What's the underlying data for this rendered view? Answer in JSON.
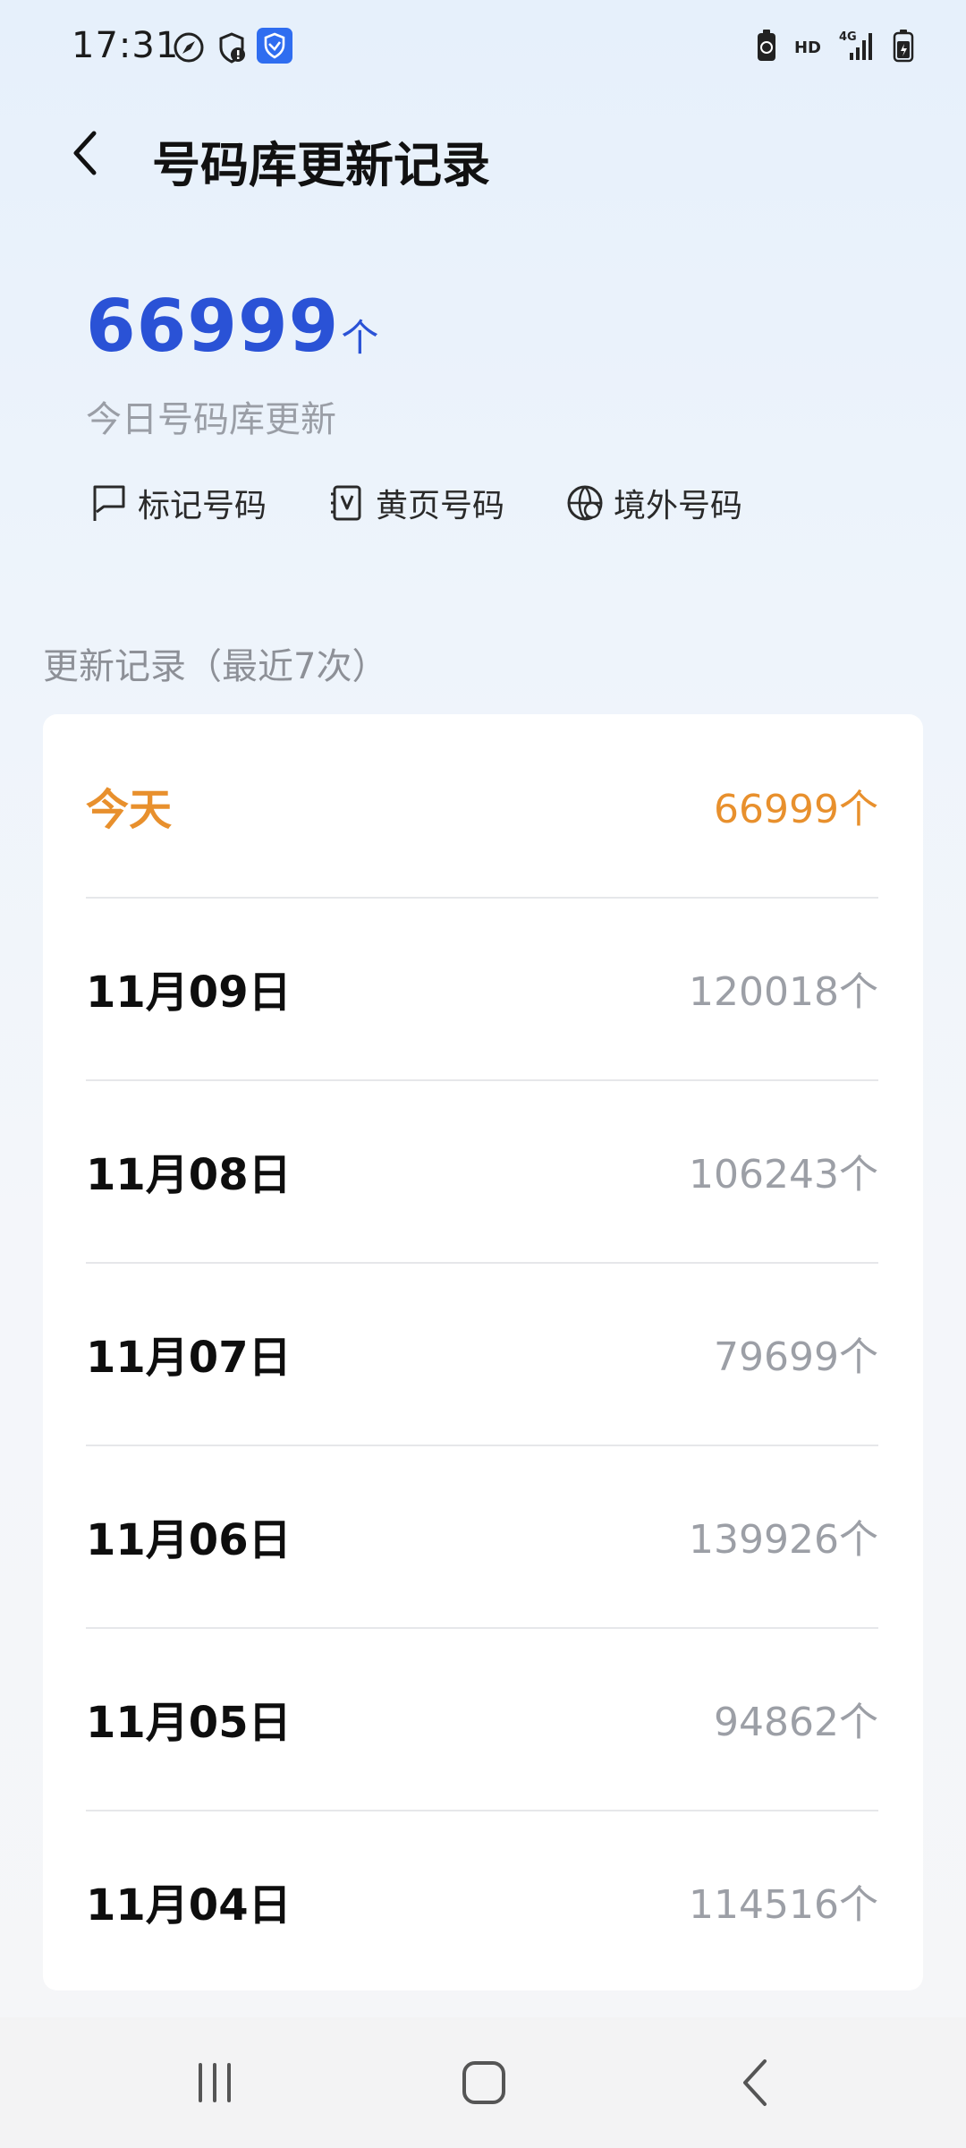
{
  "status_bar": {
    "time": "17:31",
    "left_icons": [
      "compass-icon",
      "shield-alert-icon",
      "shield-check-icon"
    ],
    "right_icons": [
      "battery-saver-icon",
      "hd-label",
      "4g-signal-icon",
      "battery-icon"
    ],
    "hd_text": "HD",
    "network_text": "4G"
  },
  "header": {
    "title": "号码库更新记录"
  },
  "summary": {
    "count": "66999",
    "unit": "个",
    "subtitle": "今日号码库更新",
    "categories": [
      {
        "label": "标记号码",
        "icon": "flag-icon"
      },
      {
        "label": "黄页号码",
        "icon": "yellow-pages-icon"
      },
      {
        "label": "境外号码",
        "icon": "globe-phone-icon"
      }
    ]
  },
  "records": {
    "section_title": "更新记录（最近7次）",
    "items": [
      {
        "date": "今天",
        "count": "66999个"
      },
      {
        "date": "11月09日",
        "count": "120018个"
      },
      {
        "date": "11月08日",
        "count": "106243个"
      },
      {
        "date": "11月07日",
        "count": "79699个"
      },
      {
        "date": "11月06日",
        "count": "139926个"
      },
      {
        "date": "11月05日",
        "count": "94862个"
      },
      {
        "date": "11月04日",
        "count": "114516个"
      }
    ]
  },
  "nav_bar": {
    "buttons": [
      "recent-apps-icon",
      "home-icon",
      "back-icon"
    ]
  },
  "colors": {
    "accent_blue": "#2a52d6",
    "today_orange": "#e8902d",
    "muted_gray": "#9c9fa6"
  }
}
